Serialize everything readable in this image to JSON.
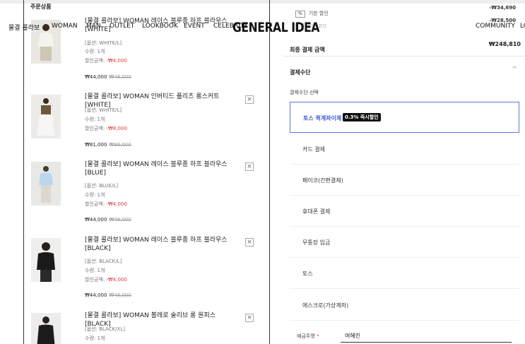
{
  "nav": {
    "items_left": [
      "물결 콜라보",
      "WOMAN",
      "MAN",
      "OUTLET",
      "LOOKBOOK",
      "EVENT",
      "CELEBRITY"
    ],
    "logo": "GENERAL IDEA",
    "items_right": [
      "COMMUNITY",
      "LO"
    ]
  },
  "order": {
    "section_title": "주문상품",
    "items": [
      {
        "name": "[물결 콜라보] WOMAN 레이스 블루종 하프 블라우스 [WHITE]",
        "option": "[옵션: WHITE/L]",
        "qty": "수량: 1개",
        "discount_label": "할인금액:",
        "discount": "-₩4,000",
        "price": "₩44,000",
        "orig_price": "₩48,000",
        "close": "×"
      },
      {
        "name": "[물결 콜라보] WOMAN 인버티드 플리츠 롱스커트 [WHITE]",
        "option": "[옵션: WHITE/L]",
        "qty": "수량: 1개",
        "discount_label": "할인금액:",
        "discount": "-₩8,000",
        "price": "₩81,000",
        "orig_price": "₩89,000",
        "close": "×"
      },
      {
        "name": "[물결 콜라보] WOMAN 레이스 블루종 하프 블라우스 [BLUE]",
        "option": "[옵션: BLUE/L]",
        "qty": "수량: 1개",
        "discount_label": "할인금액:",
        "discount": "-₩4,000",
        "price": "₩44,000",
        "orig_price": "₩48,000",
        "close": "×"
      },
      {
        "name": "[물결 콜라보] WOMAN 레이스 블루종 하프 블라우스 [BLACK]",
        "option": "[옵션: BLACK/L]",
        "qty": "수량: 1개",
        "discount_label": "할인금액:",
        "discount": "-₩4,000",
        "price": "₩44,000",
        "orig_price": "₩48,000",
        "close": "×"
      },
      {
        "name": "[물결 콜라보] WOMAN 볼레로 술리브 롱 원피스 [BLACK]",
        "option": "[옵션: BLACK/XL]",
        "qty": "수량: 1개",
        "close": "×"
      }
    ]
  },
  "summary": {
    "basic_discount_label": "기본 할인",
    "basic_discount_badge": "%",
    "basic_discount_value": "-₩34,690",
    "code_label": "할인 코드",
    "code_value": "-₩28,500",
    "final_label": "최종 결제 금액",
    "final_value": "₩248,810"
  },
  "payment": {
    "section_title": "결제수단",
    "collapse_icon": "^",
    "select_label": "결제수단 선택",
    "options": [
      {
        "label": "토스 퀵계좌이체",
        "badge": "0.3% 즉시할인"
      },
      {
        "label": "카드 결제"
      },
      {
        "label": "페이코(간편결제)"
      },
      {
        "label": "휴대폰 결제"
      },
      {
        "label": "무통장 입금"
      },
      {
        "label": "토스"
      },
      {
        "label": "에스크로(가상계좌)"
      }
    ],
    "depositor_label": "예금주명",
    "depositor_required": "*",
    "depositor_value": "여혜린"
  },
  "colors": {
    "accent": "#3f5fd6",
    "discount_red": "#e23b3b"
  }
}
